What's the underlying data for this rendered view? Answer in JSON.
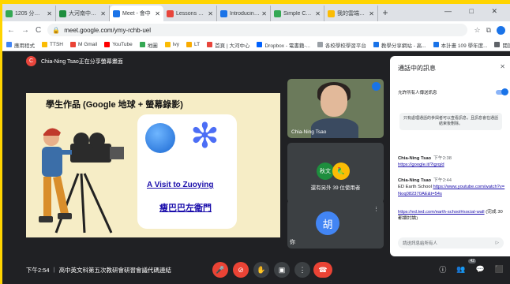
{
  "browser": {
    "tabs": [
      {
        "label": "1205 分享教案",
        "color": "#34a853",
        "active": false
      },
      {
        "label": "大河南中12/6(一",
        "color": "#1e8e3e",
        "active": false
      },
      {
        "label": "Meet - 會中",
        "color": "#1a73e8",
        "active": true
      },
      {
        "label": "Lessons Worth",
        "color": "#e8453c",
        "active": false
      },
      {
        "label": "Introducing Ea",
        "color": "#1a73e8",
        "active": false
      },
      {
        "label": "Simple Collabo",
        "color": "#34a853",
        "active": false
      },
      {
        "label": "我的雲端硬碟 - (",
        "color": "#fbbc04",
        "active": false
      }
    ],
    "new_tab": "+",
    "window_controls": "— □ ✕",
    "url": "meet.google.com/ymy-rchb-uel",
    "bookmarks": [
      "應用程式",
      "TTSH",
      "M Gmail",
      "YouTube",
      "地圖",
      "Ivy",
      "LT",
      "首頁 | 大河中心",
      "Dropbox - 電書籍-...",
      "各校學校學習平台",
      "教學分享網站 - 高...",
      "本計畫 109 學年度...",
      "閱讀清單"
    ]
  },
  "meet": {
    "presenting_initial": "C",
    "presenting_text": "Chia-Ning Tsao正在分享螢幕畫面",
    "slide": {
      "title": "學生作品 (Google 地球 + 螢幕錄影)",
      "link1": "A Visit to Zuoying",
      "link2": "瘦巴巴左衛門"
    },
    "speaker_name": "Chia-Ning Tsao",
    "others_avatar1": "秋文",
    "others_avatar2": "🦜",
    "others_text": "還有另外 39 位使用者",
    "self_avatar": "胡",
    "self_name": "你",
    "self_more": "⋮",
    "meeting_time": "下午2:54",
    "meeting_title": "高中英文科第五次教研會研習會議代碼連結",
    "participants_badge": "42"
  },
  "chat": {
    "title": "通話中的訊息",
    "close": "✕",
    "allow_label": "允許所有人傳送訊息",
    "notice": "只有處理通話的參與者可以查看訊息，且訊息會在通話結束後刪除。",
    "messages": [
      {
        "sender": "Chia-Ning Tsao",
        "time": "下午2:38",
        "text": "",
        "link": "https://google.it/?igrq/d"
      },
      {
        "sender": "Chia-Ning Tsao",
        "time": "下午2:44",
        "text": "ED Earth School",
        "link": "https://www.youtube.com/watch?v=Noq082370AE&t=54s"
      },
      {
        "sender": "",
        "time": "",
        "text": "(完成 30 都讓討論)",
        "link": "https://ed.ted.com/earth-school#social-wall"
      }
    ],
    "input_placeholder": "請送訊息給所有人",
    "send": "▷"
  },
  "icons": {
    "back": "←",
    "forward": "→",
    "reload": "C",
    "mic": "🎤",
    "cam": "⊘",
    "hand": "✋",
    "present": "▣",
    "more": "⋮",
    "end": "☎",
    "info": "ⓘ",
    "people": "👥",
    "chat": "💬",
    "activities": "⬛"
  }
}
